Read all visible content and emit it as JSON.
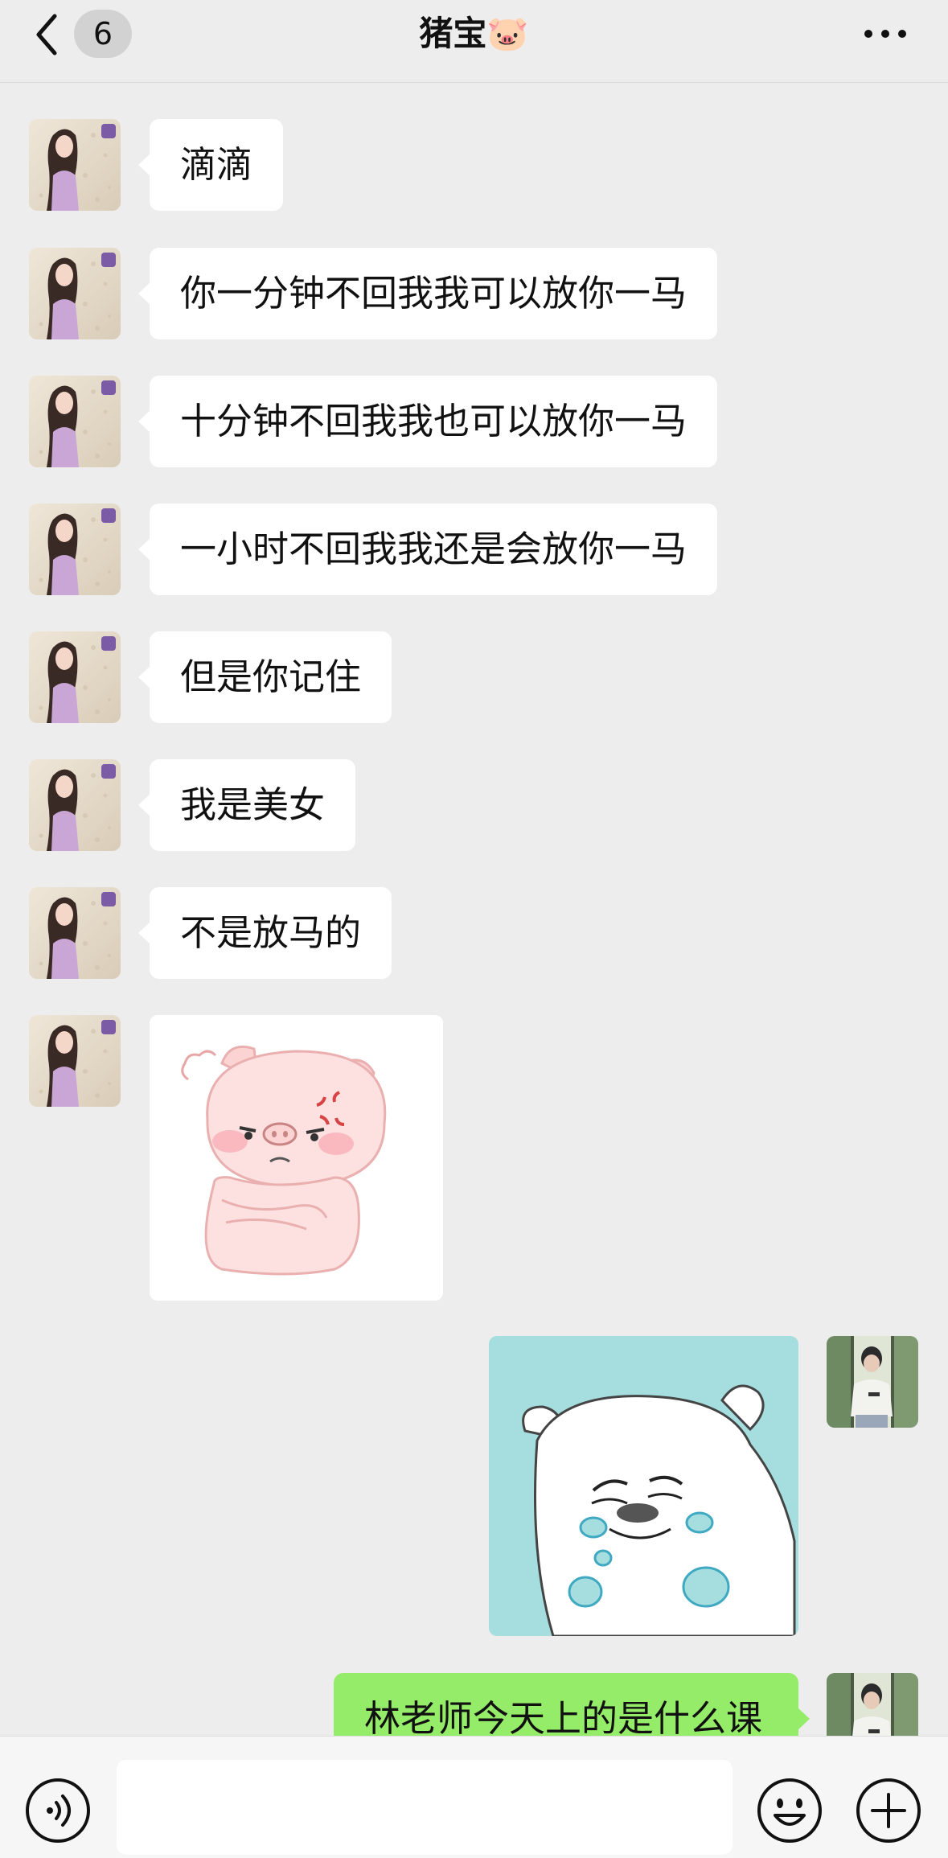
{
  "header": {
    "unread_count": "6",
    "title": "猪宝🐷"
  },
  "messages": {
    "m1": "滴滴",
    "m2": "你一分钟不回我我可以放你一马",
    "m3": "十分钟不回我我也可以放你一马",
    "m4": "一小时不回我我还是会放你一马",
    "m5": "但是你记住",
    "m6": "我是美女",
    "m7": "不是放马的",
    "m8": "林老师今天上的是什么课"
  },
  "input": {
    "placeholder": ""
  },
  "icons": {
    "back": "chevron-left-icon",
    "more": "more-dots-icon",
    "voice": "voice-icon",
    "emoji": "emoji-icon",
    "plus": "plus-icon"
  },
  "colors": {
    "background": "#ededed",
    "bubble_left": "#ffffff",
    "bubble_right": "#95ec69",
    "sticker_bg": "#a6dee0"
  }
}
